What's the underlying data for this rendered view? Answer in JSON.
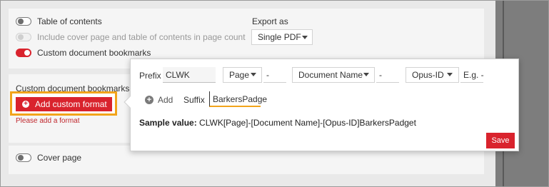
{
  "options": {
    "toc_label": "Table of contents",
    "include_cover_label": "Include cover page and table of contents in page count",
    "custom_bookmarks_label": "Custom document bookmarks",
    "cover_page_label": "Cover page"
  },
  "export": {
    "label": "Export as",
    "value": "Single PDF"
  },
  "bookmarks": {
    "section_title": "Custom document bookmarks",
    "add_button_label": "Add custom format",
    "error_text": "Please add a format"
  },
  "popup": {
    "prefix_label": "Prefix",
    "prefix_value": "CLWK",
    "select_1": "Page",
    "sep_1": "-",
    "select_2": "Document Name",
    "sep_2": "-",
    "select_3": "Opus-ID",
    "eg_value": "E.g. -",
    "add_label": "Add",
    "suffix_label": "Suffix",
    "suffix_value": "BarkersPadge",
    "sample_label": "Sample value:",
    "sample_value": "CLWK[Page]-[Document Name]-[Opus-ID]BarkersPadget",
    "save_label": "Save"
  },
  "colors": {
    "accent": "#d9232d",
    "highlight": "#f2a41b"
  }
}
